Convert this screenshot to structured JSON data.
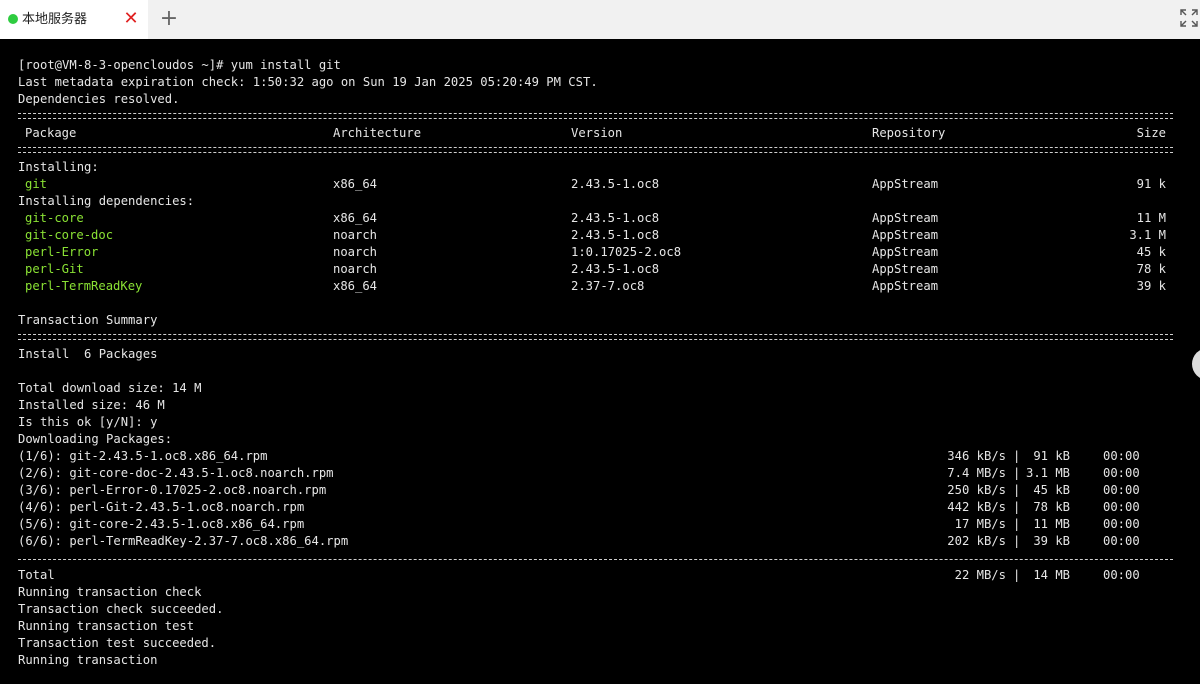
{
  "tabbar": {
    "tab_title": "本地服务器",
    "close_glyph": "✕",
    "add_glyph": "+",
    "status_color": "#2ecc40"
  },
  "terminal": {
    "command_line": "[root@VM-8-3-opencloudos ~]# yum install git",
    "metadata_line": "Last metadata expiration check: 1:50:32 ago on Sun 19 Jan 2025 05:20:49 PM CST.",
    "deps_resolved": "Dependencies resolved.",
    "table_headers": [
      "Package",
      "Architecture",
      "Version",
      "Repository",
      "Size"
    ],
    "installing_label": "Installing:",
    "installing": [
      [
        "git",
        "x86_64",
        "2.43.5-1.oc8",
        "AppStream",
        "91 k"
      ]
    ],
    "deps_label": "Installing dependencies:",
    "dependencies": [
      [
        "git-core",
        "x86_64",
        "2.43.5-1.oc8",
        "AppStream",
        "11 M"
      ],
      [
        "git-core-doc",
        "noarch",
        "2.43.5-1.oc8",
        "AppStream",
        "3.1 M"
      ],
      [
        "perl-Error",
        "noarch",
        "1:0.17025-2.oc8",
        "AppStream",
        "45 k"
      ],
      [
        "perl-Git",
        "noarch",
        "2.43.5-1.oc8",
        "AppStream",
        "78 k"
      ],
      [
        "perl-TermReadKey",
        "x86_64",
        "2.37-7.oc8",
        "AppStream",
        "39 k"
      ]
    ],
    "txn_summary": "Transaction Summary",
    "install_count": "Install  6 Packages",
    "total_download": "Total download size: 14 M",
    "installed_size": "Installed size: 46 M",
    "prompt": "Is this ok [y/N]: y",
    "downloading": "Downloading Packages:",
    "downloads": [
      [
        "(1/6): git-2.43.5-1.oc8.x86_64.rpm",
        "346 kB/s",
        "|",
        " 91 kB",
        "00:00"
      ],
      [
        "(2/6): git-core-doc-2.43.5-1.oc8.noarch.rpm",
        "7.4 MB/s",
        "|",
        "3.1 MB",
        "00:00"
      ],
      [
        "(3/6): perl-Error-0.17025-2.oc8.noarch.rpm",
        "250 kB/s",
        "|",
        " 45 kB",
        "00:00"
      ],
      [
        "(4/6): perl-Git-2.43.5-1.oc8.noarch.rpm",
        "442 kB/s",
        "|",
        " 78 kB",
        "00:00"
      ],
      [
        "(5/6): git-core-2.43.5-1.oc8.x86_64.rpm",
        "17 MB/s",
        "|",
        " 11 MB",
        "00:00"
      ],
      [
        "(6/6): perl-TermReadKey-2.37-7.oc8.x86_64.rpm",
        "202 kB/s",
        "|",
        " 39 kB",
        "00:00"
      ]
    ],
    "total_row": [
      "Total",
      "22 MB/s",
      "|",
      " 14 MB",
      "00:00"
    ],
    "tail_lines": [
      "Running transaction check",
      "Transaction check succeeded.",
      "Running transaction test",
      "Transaction test succeeded.",
      "Running transaction"
    ],
    "pkg_color": "#8ae234",
    "text_color": "#e6e6e6"
  }
}
